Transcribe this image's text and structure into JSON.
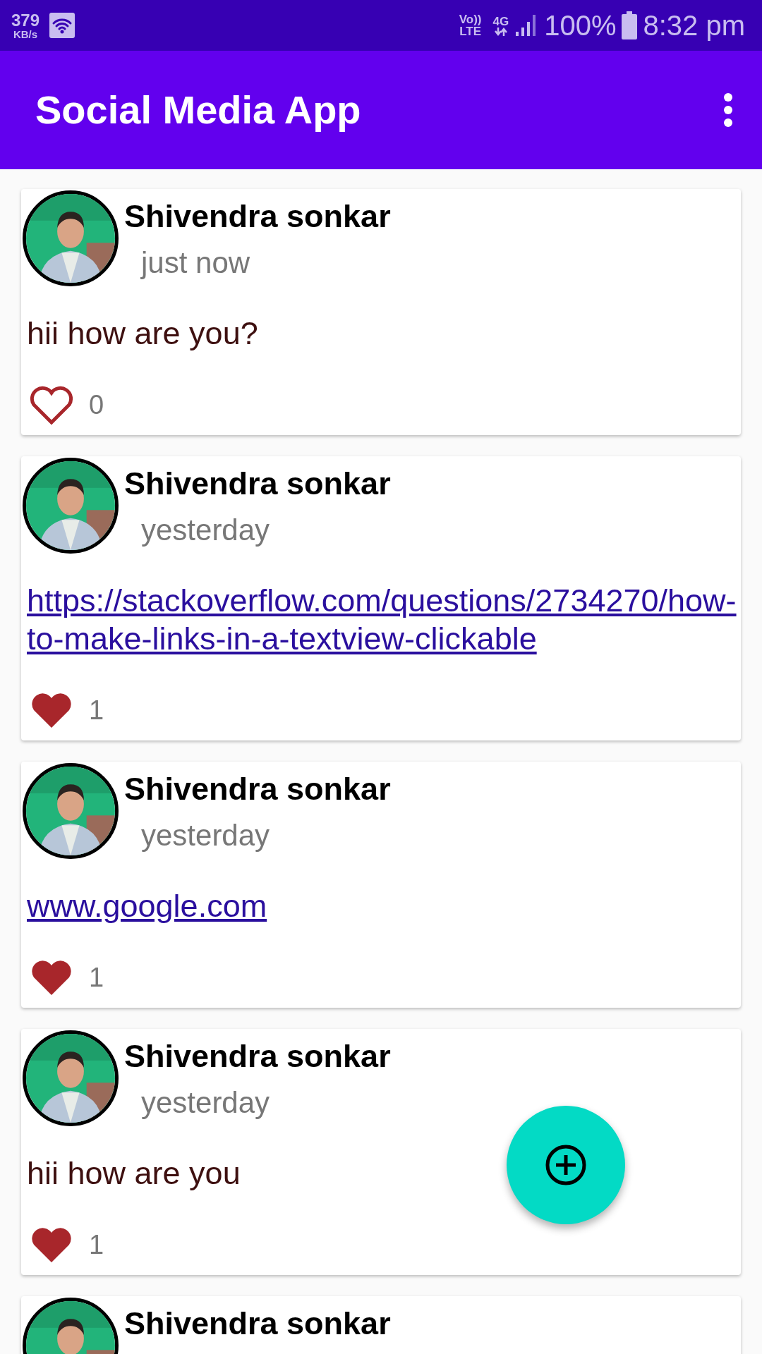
{
  "status_bar": {
    "speed": "379",
    "speed_unit": "KB/s",
    "volte_top": "Vo))",
    "volte_bottom": "LTE",
    "network": "4G",
    "battery": "100%",
    "time": "8:32 pm"
  },
  "app_bar": {
    "title": "Social Media App"
  },
  "posts": [
    {
      "author": "Shivendra sonkar",
      "time": "just now",
      "kind": "text",
      "body": "hii how are you?",
      "liked": false,
      "likes": "0"
    },
    {
      "author": "Shivendra sonkar",
      "time": "yesterday",
      "kind": "link",
      "body": "https://stackoverflow.com/questions/2734270/how-to-make-links-in-a-textview-clickable",
      "liked": true,
      "likes": "1"
    },
    {
      "author": "Shivendra sonkar",
      "time": "yesterday",
      "kind": "link",
      "body": "www.google.com",
      "liked": true,
      "likes": "1"
    },
    {
      "author": "Shivendra sonkar",
      "time": "yesterday",
      "kind": "text",
      "body": "hii how are you",
      "liked": true,
      "likes": "1"
    },
    {
      "author": "Shivendra sonkar",
      "kind": "partial"
    }
  ]
}
